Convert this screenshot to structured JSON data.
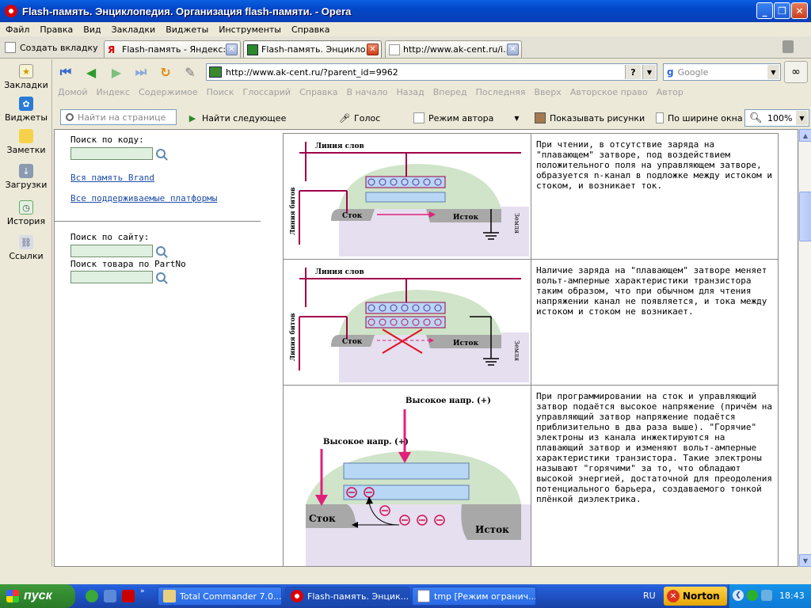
{
  "window": {
    "title": "Flash-память. Энциклопедия. Организация flash-памяти. - Opera"
  },
  "menu": [
    "Файл",
    "Правка",
    "Вид",
    "Закладки",
    "Виджеты",
    "Инструменты",
    "Справка"
  ],
  "tabs": {
    "new_tab": "Создать вкладку",
    "items": [
      {
        "label": "Flash-память - Яндекс: ...",
        "active": false
      },
      {
        "label": "Flash-память. Энцикло...",
        "active": true
      },
      {
        "label": "http://www.ak-cent.ru/i...",
        "active": false
      }
    ]
  },
  "address": {
    "url": "http://www.ak-cent.ru/?parent_id=9962",
    "search_placeholder": "Google"
  },
  "navlinks": [
    "Домой",
    "Индекс",
    "Содержимое",
    "Поиск",
    "Глоссарий",
    "Справка",
    "В начало",
    "Назад",
    "Вперед",
    "Последняя",
    "Вверх",
    "Авторское право",
    "Автор"
  ],
  "findbar": {
    "find_placeholder": "Найти на странице",
    "find_next": "Найти следующее",
    "voice": "Голос",
    "author_mode": "Режим автора",
    "show_images": "Показывать рисунки",
    "fit_width": "По ширине окна",
    "zoom": "100%"
  },
  "panel": [
    "Закладки",
    "Виджеты",
    "Заметки",
    "Загрузки",
    "История",
    "Ссылки"
  ],
  "page": {
    "search_code_label": "Поиск по коду:",
    "link_brand": "Вся память Brand",
    "link_platforms": "Все поддерживаемые платформы",
    "search_site_label": "Поиск по сайту:",
    "search_part_label": "Поиск товара по PartNo",
    "rows": [
      {
        "labels": {
          "wordline": "Линия слов",
          "bitline": "Линия битов",
          "drain": "Сток",
          "source": "Исток",
          "ground": "Земля"
        },
        "text": "При чтении, в отсутствие заряда на \"плавающем\" затворе, под воздействием положительного поля на управляющем затворе, образуется n-канал в подложке между истоком и стоком, и возникает ток."
      },
      {
        "labels": {
          "wordline": "Линия слов",
          "bitline": "Линия битов",
          "drain": "Сток",
          "source": "Исток",
          "ground": "Земля"
        },
        "text": "Наличие заряда на \"плавающем\" затворе меняет вольт-амперные характеристики транзистора таким образом, что при обычном для чтения напряжении канал не появляется, и тока между истоком и стоком не возникает."
      },
      {
        "labels": {
          "high_top": "Высокое напр. (+)",
          "high_left": "Высокое напр. (+)",
          "drain": "Сток",
          "source": "Исток"
        },
        "text": "При программировании на сток и управляющий затвор подаётся высокое напряжение (причём на управляющий затвор напряжение подаётся приблизительно в два раза выше). \"Горячие\" электроны из канала инжектируются на плавающий затвор и изменяют вольт-амперные характеристики транзистора. Такие электроны называют \"горячими\" за то, что обладают высокой энергией, достаточной для преодоления потенциального барьера, создаваемого тонкой плёнкой диэлектрика."
      }
    ]
  },
  "taskbar": {
    "start": "пуск",
    "items": [
      {
        "label": "Total Commander 7.0...",
        "active": false
      },
      {
        "label": "Flash-память. Энцик...",
        "active": true
      },
      {
        "label": "tmp [Режим огранич...",
        "active": false
      }
    ],
    "lang": "RU",
    "norton": "Norton",
    "clock": "18:43"
  },
  "colors": {
    "diagram_line": "#a0004a",
    "diagram_arrow": "#e0207a",
    "gate_blue": "#b8d7f4",
    "dome": "#cfe4c8"
  }
}
